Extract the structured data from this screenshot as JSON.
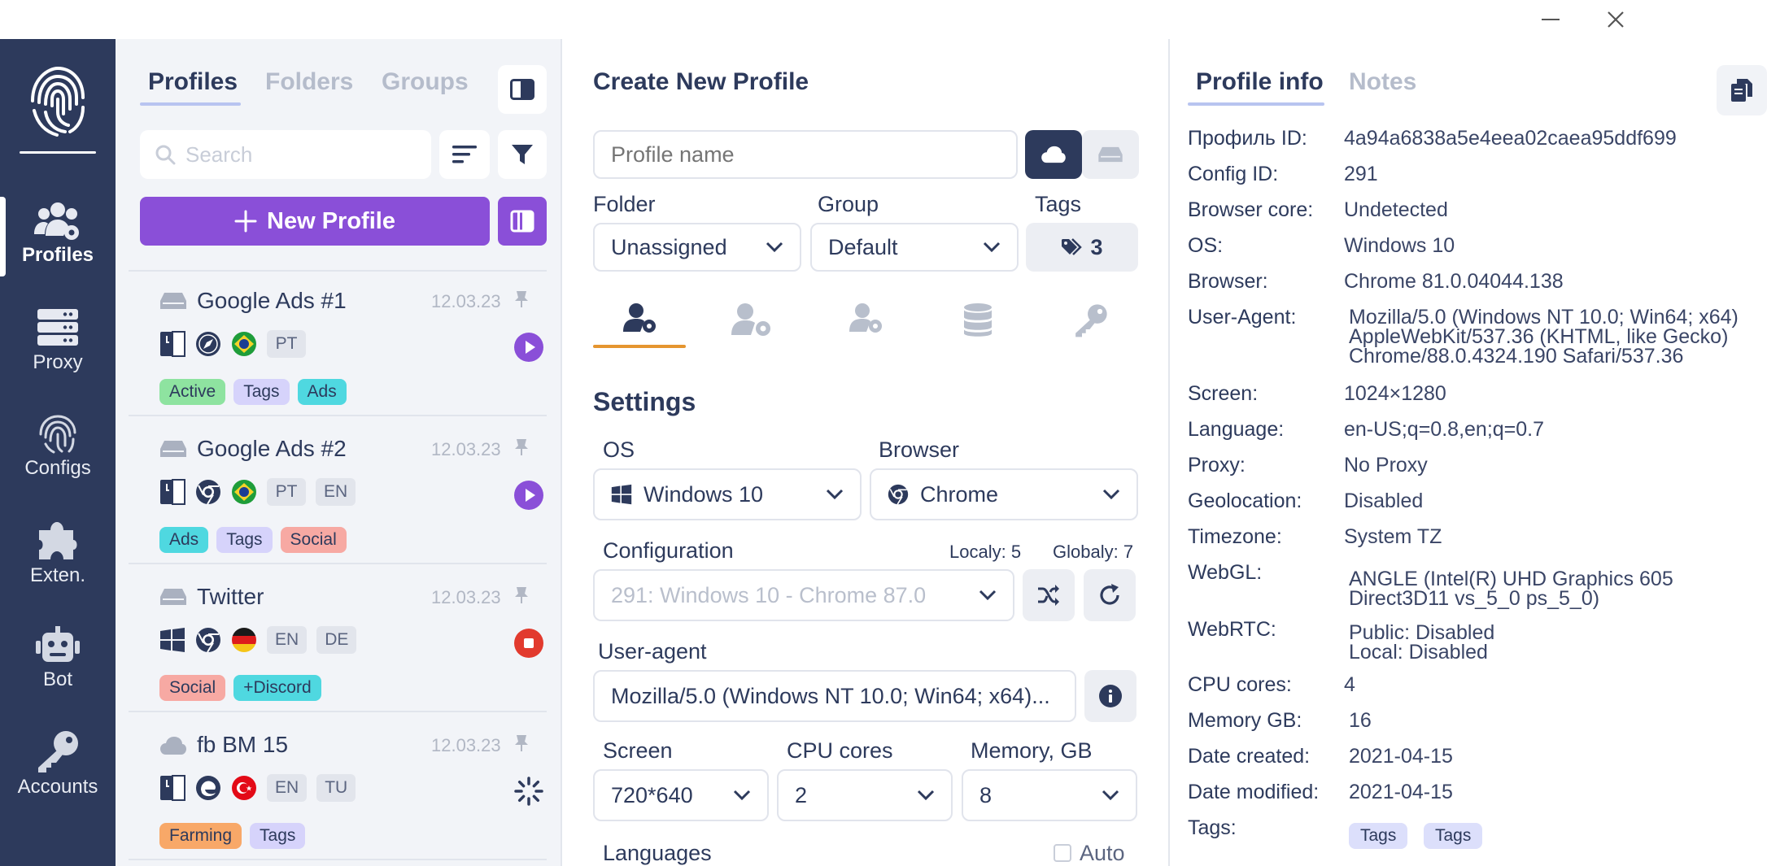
{
  "colors": {
    "sidebar_bg": "#2d3a5c",
    "accent_purple": "#8a4fd8",
    "tab_underline": "#b8c4f0",
    "settings_tab_underline": "#e5952f",
    "tag_active": "#8ee3a0",
    "tag_tags": "#d6d3fb",
    "tag_ads": "#4fd8e0",
    "tag_social": "#f7a9a3",
    "tag_discord": "#4fd8e0",
    "tag_farming": "#f8a868",
    "stop_red": "#e23a2e"
  },
  "sidebar": {
    "items": [
      {
        "label": "Profiles",
        "icon": "users-gear-icon"
      },
      {
        "label": "Proxy",
        "icon": "server-icon"
      },
      {
        "label": "Configs",
        "icon": "fingerprint-icon"
      },
      {
        "label": "Exten.",
        "icon": "puzzle-icon"
      },
      {
        "label": "Bot",
        "icon": "robot-icon"
      },
      {
        "label": "Accounts",
        "icon": "key-icon"
      }
    ]
  },
  "list": {
    "tabs": [
      "Profiles",
      "Folders",
      "Groups"
    ],
    "search_placeholder": "Search",
    "new_profile_label": "New Profile",
    "profiles": [
      {
        "name": "Google Ads #1",
        "date": "12.03.23",
        "langs": [
          "PT"
        ],
        "tags": [
          {
            "t": "Active",
            "c": "#8ee3a0"
          },
          {
            "t": "Tags",
            "c": "#d6d3fb"
          },
          {
            "t": "Ads",
            "c": "#4fd8e0"
          }
        ],
        "action": "play"
      },
      {
        "name": "Google Ads #2",
        "date": "12.03.23",
        "langs": [
          "PT",
          "EN"
        ],
        "tags": [
          {
            "t": "Ads",
            "c": "#4fd8e0"
          },
          {
            "t": "Tags",
            "c": "#d6d3fb"
          },
          {
            "t": "Social",
            "c": "#f7a9a3"
          }
        ],
        "action": "play"
      },
      {
        "name": "Twitter",
        "date": "12.03.23",
        "langs": [
          "EN",
          "DE"
        ],
        "tags": [
          {
            "t": "Social",
            "c": "#f7a9a3"
          },
          {
            "t": "+Discord",
            "c": "#4fd8e0"
          }
        ],
        "action": "stop"
      },
      {
        "name": "fb BM 15",
        "date": "12.03.23",
        "langs": [
          "EN",
          "TU"
        ],
        "tags": [
          {
            "t": "Farming",
            "c": "#f8a868"
          },
          {
            "t": "Tags",
            "c": "#d6d3fb"
          }
        ],
        "action": "loading"
      }
    ]
  },
  "create": {
    "title": "Create New Profile",
    "name_placeholder": "Profile name",
    "folder_label": "Folder",
    "folder_value": "Unassigned",
    "group_label": "Group",
    "group_value": "Default",
    "tags_label": "Tags",
    "tags_count": "3",
    "settings_title": "Settings",
    "os_label": "OS",
    "os_value": "Windows 10",
    "browser_label": "Browser",
    "browser_value": "Chrome",
    "config_label": "Configuration",
    "locally": "Localy: 5",
    "globally": "Globaly: 7",
    "config_value": "291: Windows 10 - Chrome 87.0",
    "ua_label": "User-agent",
    "ua_value": "Mozilla/5.0 (Windows NT 10.0; Win64; x64)...",
    "screen_label": "Screen",
    "screen_value": "720*640",
    "cpu_label": "CPU cores",
    "cpu_value": "2",
    "memory_label": "Memory, GB",
    "memory_value": "8",
    "languages_label": "Languages",
    "auto_label": "Auto"
  },
  "info": {
    "tabs": [
      "Profile info",
      "Notes"
    ],
    "rows": [
      {
        "k": "Профиль ID:",
        "v": "4a94a6838a5e4eea02caea95ddf699"
      },
      {
        "k": "Config ID:",
        "v": "291"
      },
      {
        "k": "Browser core:",
        "v": "Undetected"
      },
      {
        "k": "OS:",
        "v": "Windows 10"
      },
      {
        "k": "Browser:",
        "v": "Chrome 81.0.04044.138"
      },
      {
        "k": "User-Agent:",
        "v": "Mozilla/5.0 (Windows NT 10.0; Win64; x64)\nAppleWebKit/537.36 (KHTML, like Gecko)\nChrome/88.0.4324.190 Safari/537.36"
      },
      {
        "k": "Screen:",
        "v": "1024×1280"
      },
      {
        "k": "Language:",
        "v": "en-US;q=0.8,en;q=0.7"
      },
      {
        "k": "Proxy:",
        "v": "No Proxy"
      },
      {
        "k": "Geolocation:",
        "v": "Disabled"
      },
      {
        "k": "Timezone:",
        "v": "System TZ"
      },
      {
        "k": "WebGL:",
        "v": "ANGLE (Intel(R) UHD Graphics 605\nDirect3D11 vs_5_0 ps_5_0)"
      },
      {
        "k": "WebRTC:",
        "v": "Public: Disabled\nLocal: Disabled"
      },
      {
        "k": "CPU cores:",
        "v": "4"
      },
      {
        "k": "Memory GB:",
        "v": "16"
      },
      {
        "k": "Date created:",
        "v": "2021-04-15"
      },
      {
        "k": "Date modified:",
        "v": "2021-04-15"
      },
      {
        "k": "Tags:",
        "v": ""
      }
    ],
    "tags": [
      "Tags",
      "Tags"
    ]
  }
}
